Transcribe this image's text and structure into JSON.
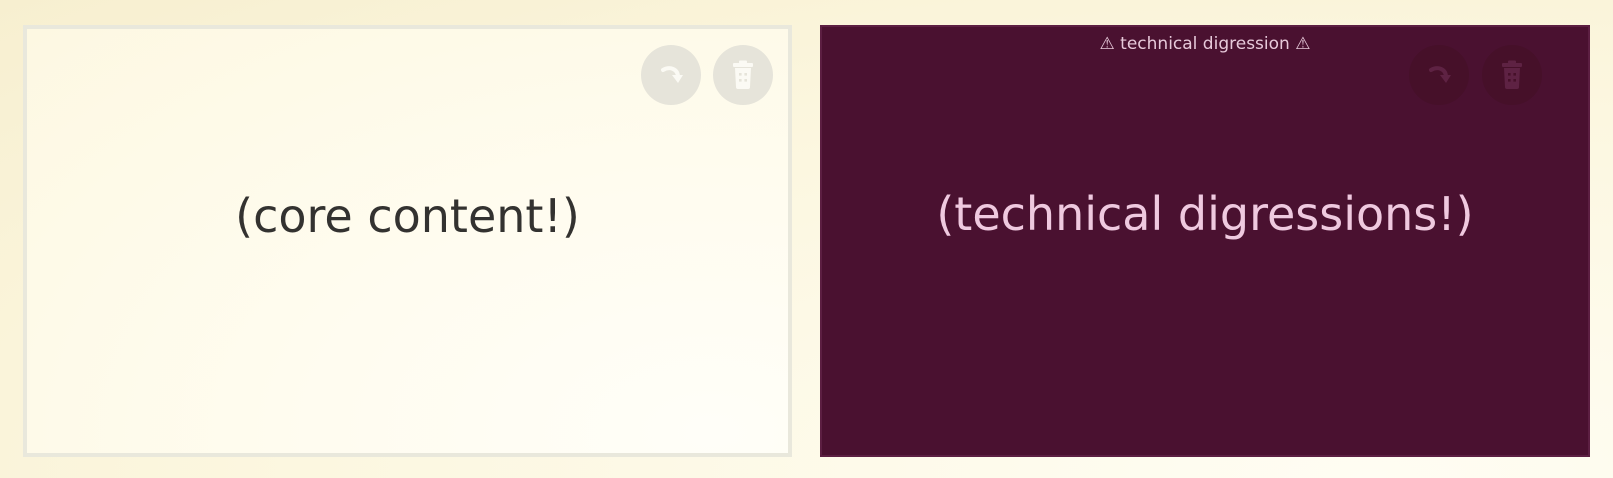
{
  "core_panel": {
    "text": "(core content!)"
  },
  "tech_panel": {
    "label": "⚠ technical digression ⚠",
    "text": "(technical digressions!)"
  },
  "controls": {
    "redo_icon": "redo-arrow",
    "delete_icon": "trash-can"
  },
  "colors": {
    "page_background": "#fbf5dc",
    "core_border": "#e9e8dc",
    "core_text": "#333230",
    "tech_background": "#4a1130",
    "tech_text": "#efc9df",
    "core_button_bg": "#e6e4da",
    "core_button_icon": "#fbfaf4",
    "tech_button_icon": "#5e2243"
  }
}
